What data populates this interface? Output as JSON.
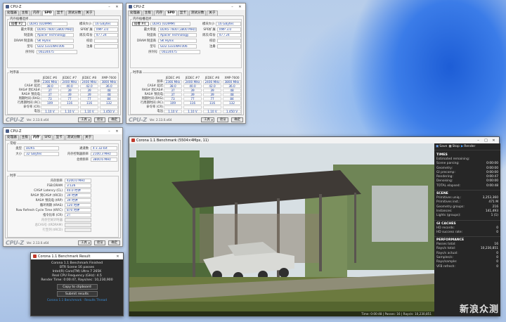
{
  "cpuz_tabs": [
    "处理器",
    "主板",
    "内存",
    "SPD",
    "显卡",
    "测试分数",
    "关于"
  ],
  "cpuz_title": "CPU-Z",
  "cpuz_logo": "CPU-Z",
  "cpuz_version": "Ver. 2.13.0.x64",
  "btn_tools": "工具",
  "btn_validate": "验证",
  "btn_ok": "确定",
  "spd": {
    "group_slot": "内存插槽选择",
    "slot_select": "插槽 #2",
    "module_type": "DDR5 (UDIMM)",
    "labels": [
      "最大带宽",
      "制造商",
      "DRAM 制造商",
      "型号",
      "序列号"
    ],
    "values": [
      "DDR5-7600 (3800 MHz)",
      "Apacer Technology",
      "SK Hynix",
      "GD2.5331WH.006",
      "00224475"
    ],
    "size_label": "模块大小",
    "size": "16 GBytes",
    "ext_label": "SPD扩展",
    "ext": "XMP 3.0",
    "week_label": "周次/年份",
    "week": "47 / 24",
    "corr_label": "校验",
    "reg_label": "注册",
    "timing_group": "时序表",
    "cols": [
      "JEDEC #6",
      "JEDEC #7",
      "JEDEC #8",
      "XMP-7600"
    ],
    "rows": [
      {
        "label": "频率",
        "vals": [
          "2366 MHz",
          "2400 MHz",
          "2400 MHz",
          "3800 MHz"
        ]
      },
      {
        "label": "CAS# 延迟",
        "vals": [
          "38.0",
          "40.0",
          "42.0",
          "36.0"
        ]
      },
      {
        "label": "RAS# 到CAS#",
        "vals": [
          "37",
          "39",
          "39",
          "48"
        ]
      },
      {
        "label": "RAS# 预充电",
        "vals": [
          "37",
          "39",
          "39",
          "48"
        ]
      },
      {
        "label": "周期时间 (RAS)",
        "vals": [
          "73",
          "77",
          "77",
          "84"
        ]
      },
      {
        "label": "行周期时间 (RC)",
        "vals": [
          "109",
          "116",
          "116",
          "132"
        ]
      },
      {
        "label": "命令率 (CR)",
        "vals": [
          "",
          "",
          "",
          ""
        ]
      },
      {
        "label": "电压",
        "vals": [
          "1.10 V",
          "1.10 V",
          "1.10 V",
          "1.450 V"
        ]
      }
    ]
  },
  "spd2": {
    "slot_select": "插槽 #4"
  },
  "mem": {
    "group_general": "常规",
    "type_label": "类型",
    "type": "DDR5",
    "size_label": "大小",
    "size": "32 GBytes",
    "channel_label": "通道数",
    "channel": "4 x 32-bit",
    "ctrl_label": "内存控制器频率",
    "ctrl": "2100.3 MHz",
    "uncore_label": "北桥频率",
    "uncore": "3800.6 MHz",
    "group_timings": "时序",
    "labels": [
      "内存频率",
      "FSB:DRAM",
      "CAS# Latency (CL)",
      "RAS# 到CAS# (tRCD)",
      "RAS# 预充电 (tRP)",
      "循环周期 (tRAS)",
      "Row Refresh Cycle Time (tRFC)",
      "指令比率 (CR)",
      "内存空闲计时器",
      "总CAS号 (tRDRAM)",
      "行至列 (tRCD)"
    ],
    "values": [
      "4200.0 MHz",
      "3:126",
      "40.0 时钟",
      "39 时钟",
      "39 时钟",
      "120 时钟",
      "870 时钟",
      "2T",
      "",
      "",
      ""
    ]
  },
  "corona": {
    "title": "Corona 1.1 Benchmark (5504×4Mpx, 11)",
    "tools": [
      "Save",
      "Stop",
      "Render"
    ],
    "sections": [
      {
        "name": "TIMES",
        "items": [
          [
            "Estimated remaining:",
            ""
          ],
          [
            "Scene parsing:",
            "0:00:00"
          ],
          [
            "Geometry:",
            "0:00:00"
          ],
          [
            "GI precomp:",
            "0:00:00"
          ],
          [
            "Rendering:",
            "0:00:47"
          ],
          [
            "Denoising:",
            "0:00:00"
          ],
          [
            "TOTAL elapsed:",
            "0:00:48"
          ]
        ]
      },
      {
        "name": "SCENE",
        "items": [
          [
            "Primitives uniq.:",
            "3,253,360"
          ],
          [
            "Primitives inst.:",
            "471 M"
          ],
          [
            "Geometry groups:",
            "216"
          ],
          [
            "Instances:",
            "141,493"
          ],
          [
            "Lights (groups):",
            "1 (1)"
          ]
        ]
      },
      {
        "name": "GI CACHES",
        "items": [
          [
            "HD records:",
            "0"
          ],
          [
            "HD success rate:",
            "0"
          ]
        ]
      },
      {
        "name": "PERFORMANCE",
        "items": [
          [
            "Passes total:",
            "16"
          ],
          [
            "Rays/s total:",
            "10,230,851"
          ],
          [
            "Rays/s actual:",
            "0"
          ],
          [
            "Samples/s:",
            "0"
          ],
          [
            "Rays/sample:",
            "0"
          ],
          [
            "VFB refresh:",
            "0"
          ]
        ]
      }
    ],
    "status": "Time: 0:00:48 | Passes: 16 | Rays/s: 10,230,851"
  },
  "result": {
    "title": "Corona 1.1 Benchmark Result",
    "lines": [
      "Corona 1.1 Benchmark Finished",
      "BTR Scene 16 passes",
      "Intel(R) Core(TM) Ultra 7 265K",
      "Real CPU Frequency (GHz): 4.5",
      "Render Time: 0:00:47, Rays/sec: 10,230,900"
    ],
    "copy": "Copy to clipboard",
    "submit": "Submit results",
    "footer": "Corona 1.1 Benchmark · Results Thread"
  },
  "watermark": "新浪众测"
}
